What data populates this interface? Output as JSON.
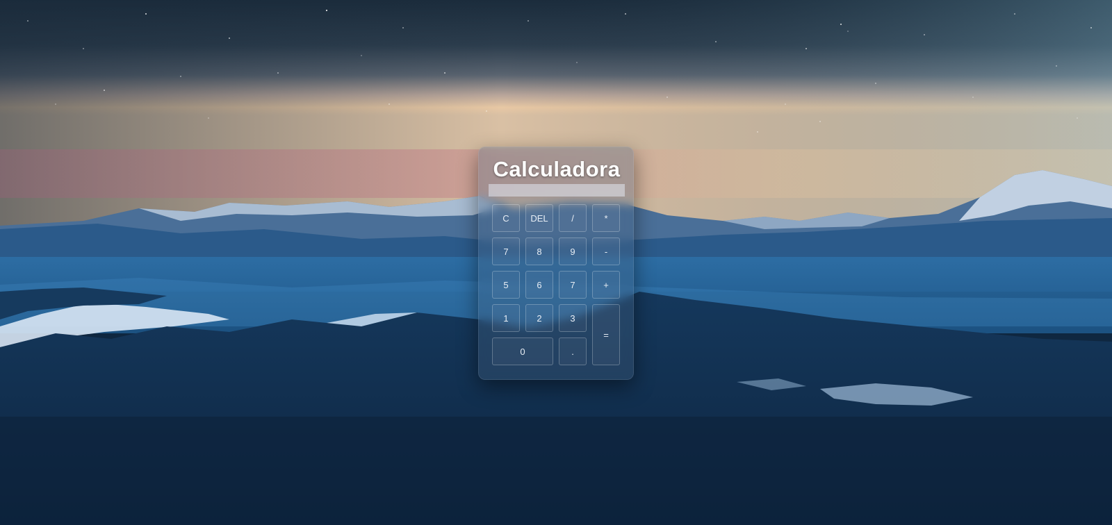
{
  "app": {
    "title": "Calculadora"
  },
  "display": {
    "value": "",
    "placeholder": ""
  },
  "keys": {
    "clear": "C",
    "delete": "DEL",
    "divide": "/",
    "multiply": "*",
    "k7a": "7",
    "k8": "8",
    "k9": "9",
    "minus": "-",
    "k5": "5",
    "k6": "6",
    "k7b": "7",
    "plus": "+",
    "k1": "1",
    "k2": "2",
    "k3": "3",
    "equals": "=",
    "k0": "0",
    "dot": "."
  },
  "colors": {
    "panel": "#46648252",
    "title": "#ffffff",
    "key_text": "#e8eef5",
    "display_bg": "#e1e8f0"
  }
}
